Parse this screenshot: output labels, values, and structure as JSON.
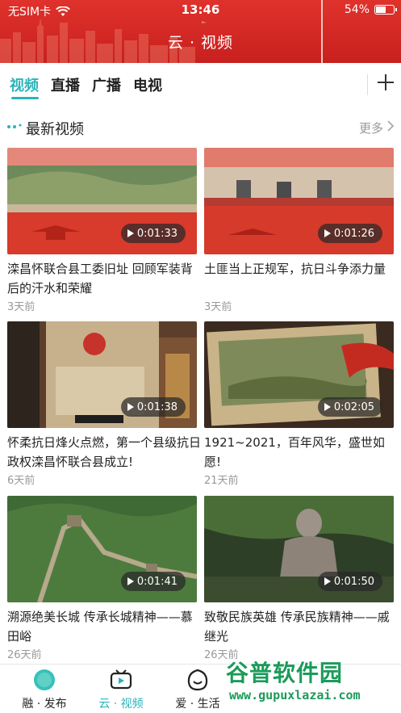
{
  "status": {
    "carrier": "无SIM卡",
    "time": "13:46",
    "battery": "54%"
  },
  "header": {
    "title": "云 · 视频"
  },
  "tabs": [
    {
      "label": "视频",
      "active": true
    },
    {
      "label": "直播",
      "active": false
    },
    {
      "label": "广播",
      "active": false
    },
    {
      "label": "电视",
      "active": false
    }
  ],
  "section": {
    "title": "最新视频",
    "more": "更多"
  },
  "videos": [
    {
      "title": "滦昌怀联合县工委旧址 回顾军装背后的汗水和荣耀",
      "duration": "0:01:33",
      "time": "3天前"
    },
    {
      "title": "土匪当上正规军，抗日斗争添力量",
      "duration": "0:01:26",
      "time": "3天前"
    },
    {
      "title": "怀柔抗日烽火点燃，第一个县级抗日政权滦昌怀联合县成立!",
      "duration": "0:01:38",
      "time": "6天前"
    },
    {
      "title": "1921~2021，百年风华，盛世如愿!",
      "duration": "0:02:05",
      "time": "21天前"
    },
    {
      "title": "溯源绝美长城 传承长城精神——慕田峪",
      "duration": "0:01:41",
      "time": "26天前"
    },
    {
      "title": "致敬民族英雄 传承民族精神——戚继光",
      "duration": "0:01:50",
      "time": "26天前"
    }
  ],
  "nav": [
    {
      "label": "融 · 发布",
      "icon": "rong-logo-icon",
      "active": false
    },
    {
      "label": "云 · 视频",
      "icon": "tv-icon",
      "active": true
    },
    {
      "label": "爱 · 生活",
      "icon": "smile-icon",
      "active": false
    }
  ],
  "watermark": {
    "text": "谷普软件园",
    "url": "www.gupuxlazai.com"
  },
  "colors": {
    "header_red": "#d42a26",
    "accent": "#2bb3ba"
  }
}
